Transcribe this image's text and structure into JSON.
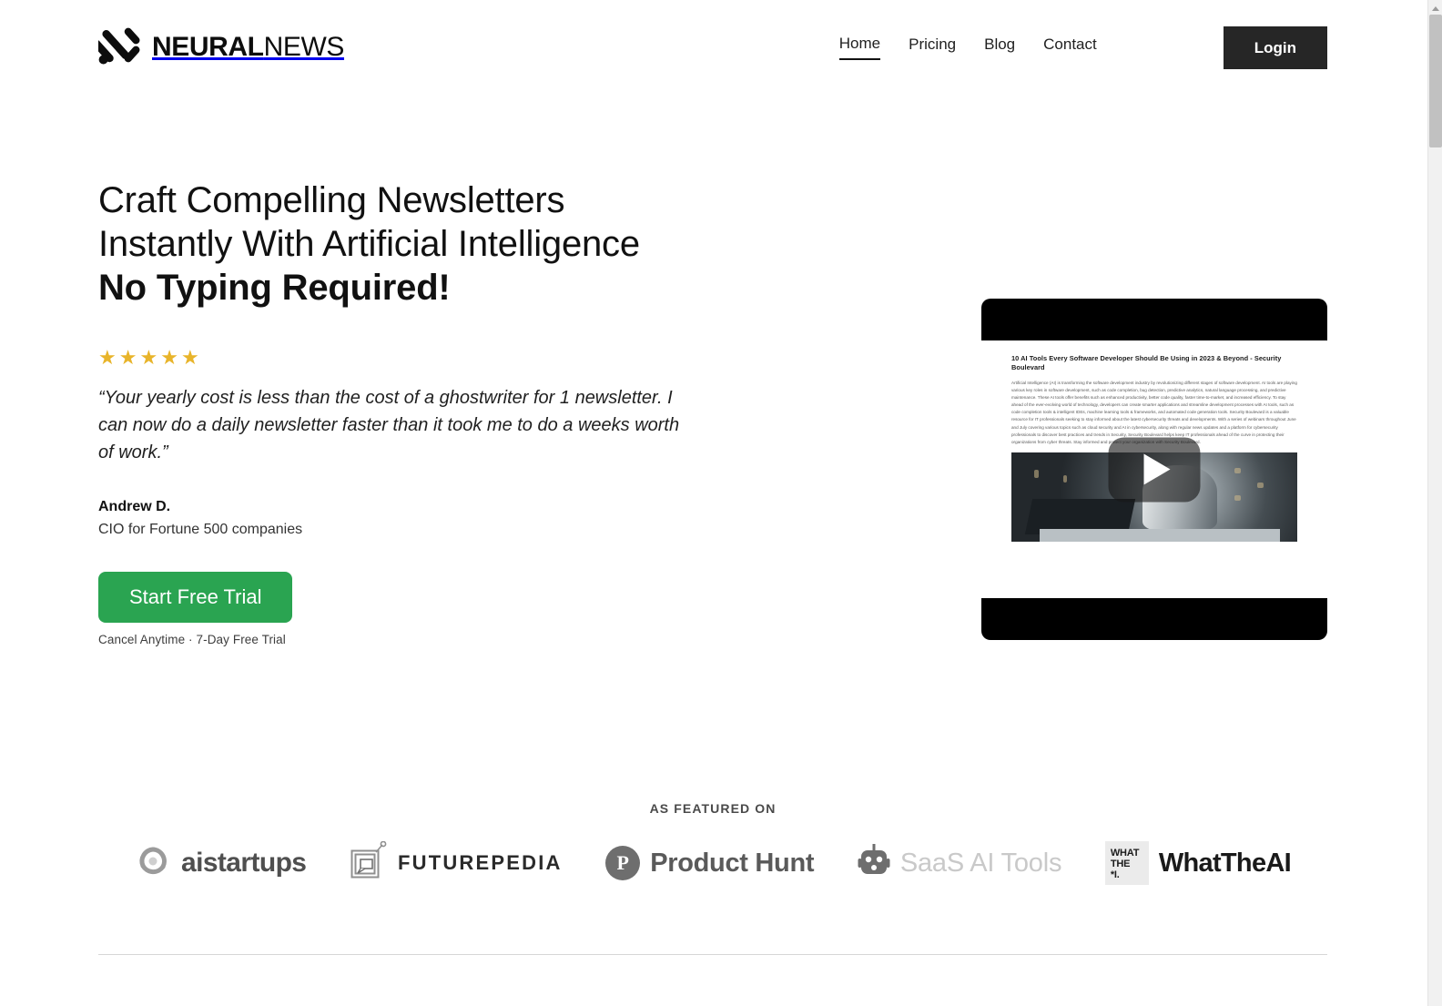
{
  "brand": {
    "logo_bold": "NEURAL",
    "logo_light": "NEWS",
    "logo_icon": "neural-mark-icon"
  },
  "nav": {
    "items": [
      {
        "label": "Home",
        "active": true
      },
      {
        "label": "Pricing",
        "active": false
      },
      {
        "label": "Blog",
        "active": false
      },
      {
        "label": "Contact",
        "active": false
      }
    ],
    "login_label": "Login"
  },
  "hero": {
    "title_line1": "Craft Compelling Newsletters",
    "title_line2": "Instantly With Artificial Intelligence",
    "title_line3": "No Typing Required!",
    "rating": 5,
    "star_glyph": "★",
    "star_color": "#e8b42a",
    "quote": "“Your yearly cost is less than the cost of a ghostwriter for 1 newsletter. I can now do a daily newsletter faster than it took me to do a weeks worth of work.”",
    "author_name": "Andrew D.",
    "author_role": "CIO for Fortune 500 companies",
    "cta_label": "Start Free Trial",
    "cta_color": "#2aa451",
    "cta_note": "Cancel Anytime · 7-Day Free Trial"
  },
  "video": {
    "play_icon": "play-triangle-icon",
    "article_title": "10 AI Tools Every Software Developer Should Be Using in 2023 & Beyond - Security Boulevard",
    "article_body": "Artificial Intelligence (AI) is transforming the software development industry by revolutionizing different stages of software development. AI tools are playing various key roles in software development, such as code completion, bug detection, predictive analytics, natural language processing, and predictive maintenance. These AI tools offer benefits such as enhanced productivity, better code quality, faster time-to-market, and increased efficiency. To stay ahead of the ever-evolving world of technology, developers can create smarter applications and streamline development processes with AI tools, such as code completion tools & intelligent IDEs, machine learning tools & frameworks, and automated code generation tools. Security Boulevard is a valuable resource for IT professionals seeking to stay informed about the latest cybersecurity threats and developments. With a series of webinars throughout June and July covering various topics such as cloud security and AI in cybersecurity, along with regular news updates and a platform for cybersecurity professionals to discover best practices and trends in Security, Security Boulevard helps keep IT professionals ahead of the curve in protecting their organizations from cyber threats. Stay informed and protect your organization with Security Boulevard."
  },
  "featured": {
    "label": "AS FEATURED ON",
    "brands": [
      {
        "name": "aistartups",
        "icon": "aistartups-swirl-icon"
      },
      {
        "name": "FUTUREPEDIA",
        "icon": "futurepedia-frame-icon"
      },
      {
        "name": "Product Hunt",
        "icon": "product-hunt-circle-icon",
        "badge": "P"
      },
      {
        "name": "SaaS AI Tools",
        "icon": "saas-ai-robot-icon"
      },
      {
        "name": "WhatTheAI",
        "icon": "whattheai-badge-icon",
        "badge_line1": "WHAT",
        "badge_line2": "THE",
        "badge_line3": "*I."
      }
    ]
  }
}
